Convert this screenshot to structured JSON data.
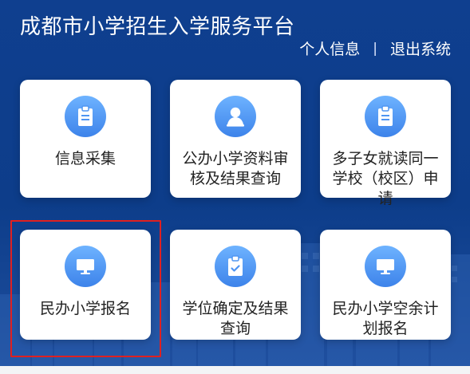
{
  "header": {
    "title": "成都市小学招生入学服务平台",
    "links": [
      {
        "label": "个人信息"
      },
      {
        "label": "退出系统"
      }
    ],
    "separator": "|"
  },
  "cards": [
    {
      "label": "信息采集",
      "icon": "clipboard-icon"
    },
    {
      "label": "公办小学资料审核及结果查询",
      "icon": "user-icon"
    },
    {
      "label": "多子女就读同一学校（校区）申请",
      "icon": "clipboard-icon"
    },
    {
      "label": "民办小学报名",
      "icon": "monitor-icon"
    },
    {
      "label": "学位确定及结果查询",
      "icon": "clipboard-check-icon"
    },
    {
      "label": "民办小学空余计划报名",
      "icon": "monitor-icon"
    }
  ],
  "colors": {
    "background": "#0f3f8f",
    "card": "#ffffff",
    "icon_gradient_top": "#6eb3ff",
    "icon_gradient_bottom": "#3d83ea",
    "highlight_border": "#e02020"
  }
}
